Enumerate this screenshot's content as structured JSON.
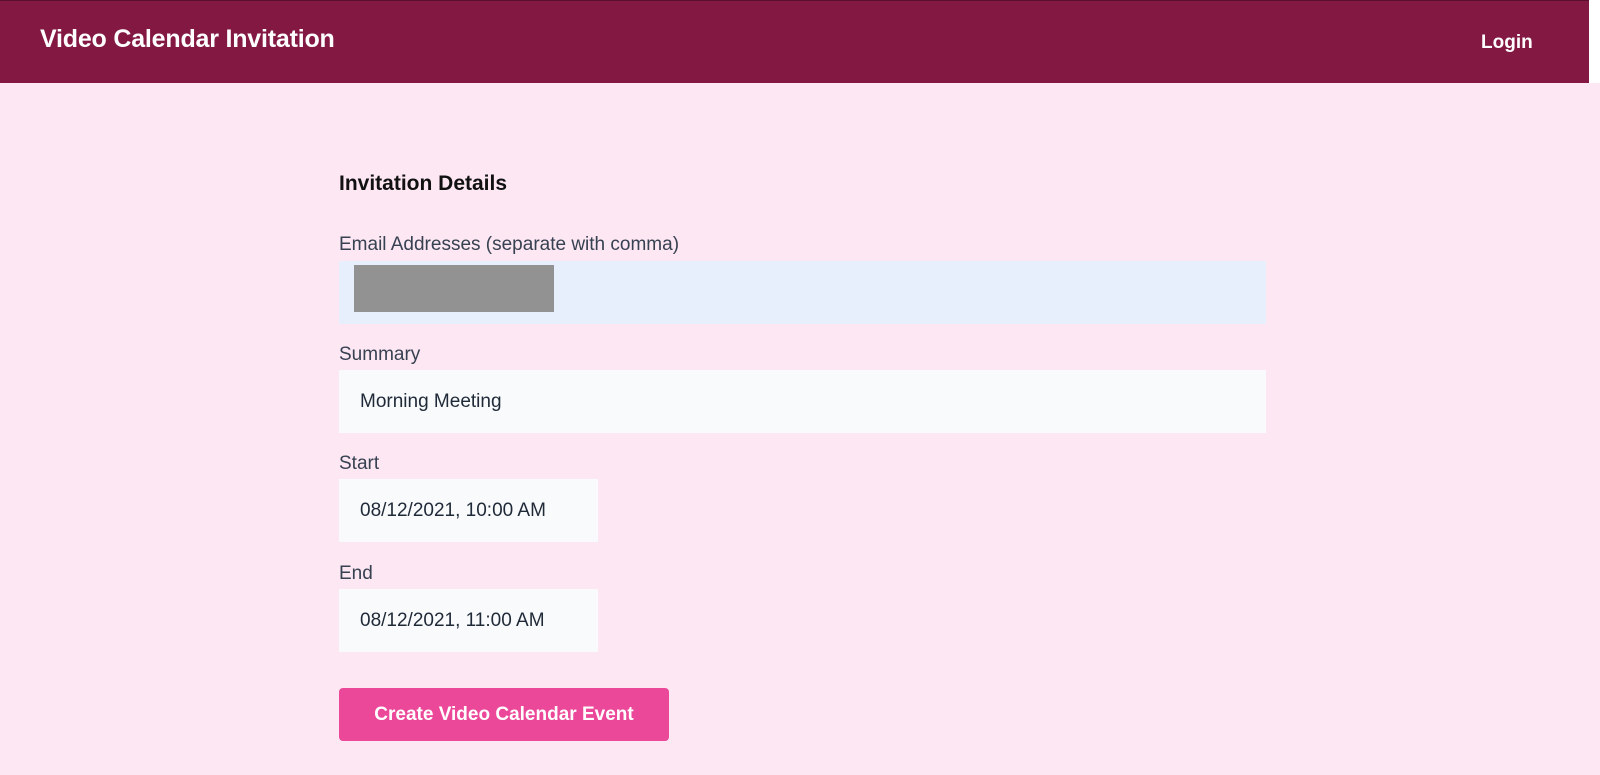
{
  "header": {
    "title": "Video Calendar Invitation",
    "login_label": "Login"
  },
  "form": {
    "section_title": "Invitation Details",
    "emails": {
      "label": "Email Addresses (separate with comma)",
      "value": ""
    },
    "summary": {
      "label": "Summary",
      "value": "Morning Meeting"
    },
    "start": {
      "label": "Start",
      "value": "08/12/2021, 10:00 AM"
    },
    "end": {
      "label": "End",
      "value": "08/12/2021, 11:00 AM"
    },
    "submit_label": "Create Video Calendar Event"
  },
  "colors": {
    "header_bg": "#831843",
    "page_bg": "#fce7f3",
    "button_bg": "#ec4899",
    "email_field_bg": "#e8effc",
    "field_bg": "#f8fafc",
    "redaction": "#929292"
  }
}
